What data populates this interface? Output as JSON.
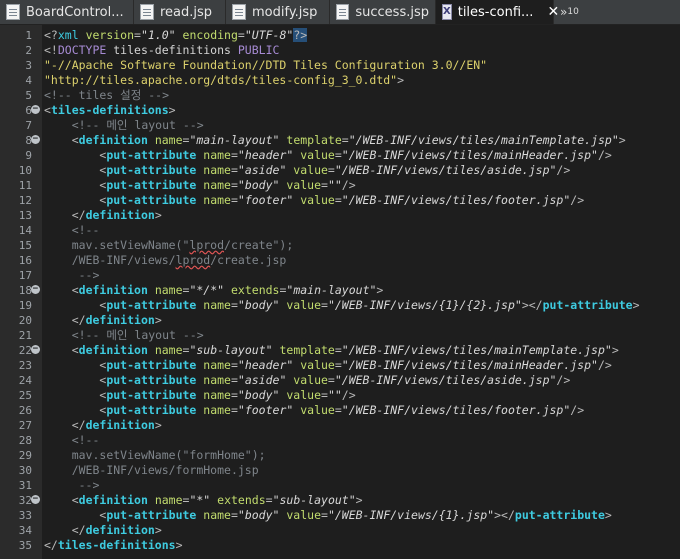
{
  "tabs": [
    {
      "label": "BoardControl...",
      "icon": "file-icon",
      "active": false
    },
    {
      "label": "read.jsp",
      "icon": "jsp-file-icon",
      "active": false
    },
    {
      "label": "modify.jsp",
      "icon": "jsp-file-icon",
      "active": false
    },
    {
      "label": "success.jsp",
      "icon": "jsp-file-icon",
      "active": false
    },
    {
      "label": "tiles-confi...",
      "icon": "xml-file-icon",
      "active": true
    }
  ],
  "overflow_label": "»",
  "overflow_count": "10",
  "close_label": "✕",
  "editor": {
    "lines": [
      {
        "n": "1",
        "fold": "",
        "segs": [
          [
            "punc",
            "<?"
          ],
          [
            "tag",
            "xml "
          ],
          [
            "attr",
            "version"
          ],
          [
            "punc",
            "="
          ],
          [
            "val",
            "\"1.0\" "
          ],
          [
            "attr",
            "encoding"
          ],
          [
            "punc",
            "="
          ],
          [
            "val",
            "\"UTF-8\""
          ],
          [
            "sel",
            "?>"
          ]
        ]
      },
      {
        "n": "2",
        "fold": "",
        "segs": [
          [
            "punc",
            "<!"
          ],
          [
            "dtk",
            "DOCTYPE "
          ],
          [
            "plain",
            "tiles-definitions "
          ],
          [
            "dtk",
            "PUBLIC"
          ]
        ]
      },
      {
        "n": "3",
        "fold": "",
        "segs": [
          [
            "dt",
            "\"-//Apache Software Foundation//DTD Tiles Configuration 3.0//EN\""
          ]
        ]
      },
      {
        "n": "4",
        "fold": "",
        "segs": [
          [
            "dt",
            "\"http://tiles.apache.org/dtds/tiles-config_3_0.dtd\""
          ],
          [
            "punc",
            ">"
          ]
        ]
      },
      {
        "n": "5",
        "fold": "",
        "segs": [
          [
            "com",
            "<!-- tiles 설정 -->"
          ]
        ]
      },
      {
        "n": "6",
        "fold": "⊖",
        "segs": [
          [
            "punc",
            "<"
          ],
          [
            "tagb",
            "tiles-definitions"
          ],
          [
            "punc",
            ">"
          ]
        ]
      },
      {
        "n": "7",
        "fold": "",
        "segs": [
          [
            "plain",
            "    "
          ],
          [
            "com",
            "<!-- 메인 layout -->"
          ]
        ]
      },
      {
        "n": "8",
        "fold": "⊖",
        "segs": [
          [
            "plain",
            "    "
          ],
          [
            "punc",
            "<"
          ],
          [
            "tagb",
            "definition "
          ],
          [
            "attr",
            "name"
          ],
          [
            "punc",
            "="
          ],
          [
            "val",
            "\"main-layout\" "
          ],
          [
            "attr",
            "template"
          ],
          [
            "punc",
            "="
          ],
          [
            "val",
            "\"/WEB-INF/views/tiles/mainTemplate.jsp\""
          ],
          [
            "punc",
            ">"
          ]
        ]
      },
      {
        "n": "9",
        "fold": "",
        "segs": [
          [
            "plain",
            "        "
          ],
          [
            "punc",
            "<"
          ],
          [
            "tagb",
            "put-attribute "
          ],
          [
            "attr",
            "name"
          ],
          [
            "punc",
            "="
          ],
          [
            "val",
            "\"header\" "
          ],
          [
            "attr",
            "value"
          ],
          [
            "punc",
            "="
          ],
          [
            "val",
            "\"/WEB-INF/views/tiles/mainHeader.jsp\""
          ],
          [
            "punc",
            "/>"
          ]
        ]
      },
      {
        "n": "10",
        "fold": "",
        "segs": [
          [
            "plain",
            "        "
          ],
          [
            "punc",
            "<"
          ],
          [
            "tagb",
            "put-attribute "
          ],
          [
            "attr",
            "name"
          ],
          [
            "punc",
            "="
          ],
          [
            "val",
            "\"aside\" "
          ],
          [
            "attr",
            "value"
          ],
          [
            "punc",
            "="
          ],
          [
            "val",
            "\"/WEB-INF/views/tiles/aside.jsp\""
          ],
          [
            "punc",
            "/>"
          ]
        ]
      },
      {
        "n": "11",
        "fold": "",
        "segs": [
          [
            "plain",
            "        "
          ],
          [
            "punc",
            "<"
          ],
          [
            "tagb",
            "put-attribute "
          ],
          [
            "attr",
            "name"
          ],
          [
            "punc",
            "="
          ],
          [
            "val",
            "\"body\" "
          ],
          [
            "attr",
            "value"
          ],
          [
            "punc",
            "="
          ],
          [
            "val",
            "\"\""
          ],
          [
            "punc",
            "/>"
          ]
        ]
      },
      {
        "n": "12",
        "fold": "",
        "segs": [
          [
            "plain",
            "        "
          ],
          [
            "punc",
            "<"
          ],
          [
            "tagb",
            "put-attribute "
          ],
          [
            "attr",
            "name"
          ],
          [
            "punc",
            "="
          ],
          [
            "val",
            "\"footer\" "
          ],
          [
            "attr",
            "value"
          ],
          [
            "punc",
            "="
          ],
          [
            "val",
            "\"/WEB-INF/views/tiles/footer.jsp\""
          ],
          [
            "punc",
            "/>"
          ]
        ]
      },
      {
        "n": "13",
        "fold": "",
        "segs": [
          [
            "plain",
            "    "
          ],
          [
            "punc",
            "</"
          ],
          [
            "tagb",
            "definition"
          ],
          [
            "punc",
            ">"
          ]
        ]
      },
      {
        "n": "14",
        "fold": "",
        "segs": [
          [
            "plain",
            "    "
          ],
          [
            "com",
            "<!--"
          ]
        ]
      },
      {
        "n": "15",
        "fold": "",
        "segs": [
          [
            "plain",
            "    "
          ],
          [
            "com",
            "mav.setViewName(\""
          ],
          [
            "comsq",
            "lprod"
          ],
          [
            "com",
            "/create\");"
          ]
        ]
      },
      {
        "n": "16",
        "fold": "",
        "segs": [
          [
            "plain",
            "    "
          ],
          [
            "com",
            "/WEB-INF/views/"
          ],
          [
            "comsq",
            "lprod"
          ],
          [
            "com",
            "/create.jsp"
          ]
        ]
      },
      {
        "n": "17",
        "fold": "",
        "segs": [
          [
            "plain",
            "     "
          ],
          [
            "com",
            "-->"
          ]
        ]
      },
      {
        "n": "18",
        "fold": "⊖",
        "segs": [
          [
            "plain",
            "    "
          ],
          [
            "punc",
            "<"
          ],
          [
            "tagb",
            "definition "
          ],
          [
            "attr",
            "name"
          ],
          [
            "punc",
            "="
          ],
          [
            "val",
            "\"*/*\" "
          ],
          [
            "attr",
            "extends"
          ],
          [
            "punc",
            "="
          ],
          [
            "val",
            "\"main-layout\""
          ],
          [
            "punc",
            ">"
          ]
        ]
      },
      {
        "n": "19",
        "fold": "",
        "segs": [
          [
            "plain",
            "        "
          ],
          [
            "punc",
            "<"
          ],
          [
            "tagb",
            "put-attribute "
          ],
          [
            "attr",
            "name"
          ],
          [
            "punc",
            "="
          ],
          [
            "val",
            "\"body\" "
          ],
          [
            "attr",
            "value"
          ],
          [
            "punc",
            "="
          ],
          [
            "val",
            "\"/WEB-INF/views/{1}/{2}.jsp\""
          ],
          [
            "punc",
            "></"
          ],
          [
            "tagb",
            "put-attribute"
          ],
          [
            "punc",
            ">"
          ]
        ]
      },
      {
        "n": "20",
        "fold": "",
        "segs": [
          [
            "plain",
            "    "
          ],
          [
            "punc",
            "</"
          ],
          [
            "tagb",
            "definition"
          ],
          [
            "punc",
            ">"
          ]
        ]
      },
      {
        "n": "21",
        "fold": "",
        "segs": [
          [
            "plain",
            "    "
          ],
          [
            "com",
            "<!-- 메인 layout -->"
          ]
        ]
      },
      {
        "n": "22",
        "fold": "⊖",
        "segs": [
          [
            "plain",
            "    "
          ],
          [
            "punc",
            "<"
          ],
          [
            "tagb",
            "definition "
          ],
          [
            "attr",
            "name"
          ],
          [
            "punc",
            "="
          ],
          [
            "val",
            "\"sub-layout\" "
          ],
          [
            "attr",
            "template"
          ],
          [
            "punc",
            "="
          ],
          [
            "val",
            "\"/WEB-INF/views/tiles/mainTemplate.jsp\""
          ],
          [
            "punc",
            ">"
          ]
        ]
      },
      {
        "n": "23",
        "fold": "",
        "segs": [
          [
            "plain",
            "        "
          ],
          [
            "punc",
            "<"
          ],
          [
            "tagb",
            "put-attribute "
          ],
          [
            "attr",
            "name"
          ],
          [
            "punc",
            "="
          ],
          [
            "val",
            "\"header\" "
          ],
          [
            "attr",
            "value"
          ],
          [
            "punc",
            "="
          ],
          [
            "val",
            "\"/WEB-INF/views/tiles/mainHeader.jsp\""
          ],
          [
            "punc",
            "/>"
          ]
        ]
      },
      {
        "n": "24",
        "fold": "",
        "segs": [
          [
            "plain",
            "        "
          ],
          [
            "punc",
            "<"
          ],
          [
            "tagb",
            "put-attribute "
          ],
          [
            "attr",
            "name"
          ],
          [
            "punc",
            "="
          ],
          [
            "val",
            "\"aside\" "
          ],
          [
            "attr",
            "value"
          ],
          [
            "punc",
            "="
          ],
          [
            "val",
            "\"/WEB-INF/views/tiles/aside.jsp\""
          ],
          [
            "punc",
            "/>"
          ]
        ]
      },
      {
        "n": "25",
        "fold": "",
        "segs": [
          [
            "plain",
            "        "
          ],
          [
            "punc",
            "<"
          ],
          [
            "tagb",
            "put-attribute "
          ],
          [
            "attr",
            "name"
          ],
          [
            "punc",
            "="
          ],
          [
            "val",
            "\"body\" "
          ],
          [
            "attr",
            "value"
          ],
          [
            "punc",
            "="
          ],
          [
            "val",
            "\"\""
          ],
          [
            "punc",
            "/>"
          ]
        ]
      },
      {
        "n": "26",
        "fold": "",
        "segs": [
          [
            "plain",
            "        "
          ],
          [
            "punc",
            "<"
          ],
          [
            "tagb",
            "put-attribute "
          ],
          [
            "attr",
            "name"
          ],
          [
            "punc",
            "="
          ],
          [
            "val",
            "\"footer\" "
          ],
          [
            "attr",
            "value"
          ],
          [
            "punc",
            "="
          ],
          [
            "val",
            "\"/WEB-INF/views/tiles/footer.jsp\""
          ],
          [
            "punc",
            "/>"
          ]
        ]
      },
      {
        "n": "27",
        "fold": "",
        "segs": [
          [
            "plain",
            "    "
          ],
          [
            "punc",
            "</"
          ],
          [
            "tagb",
            "definition"
          ],
          [
            "punc",
            ">"
          ]
        ]
      },
      {
        "n": "28",
        "fold": "",
        "segs": [
          [
            "plain",
            "    "
          ],
          [
            "com",
            "<!--"
          ]
        ]
      },
      {
        "n": "29",
        "fold": "",
        "segs": [
          [
            "plain",
            "    "
          ],
          [
            "com",
            "mav.setViewName(\"formHome\");"
          ]
        ]
      },
      {
        "n": "30",
        "fold": "",
        "segs": [
          [
            "plain",
            "    "
          ],
          [
            "com",
            "/WEB-INF/views/formHome.jsp"
          ]
        ]
      },
      {
        "n": "31",
        "fold": "",
        "segs": [
          [
            "plain",
            "     "
          ],
          [
            "com",
            "-->"
          ]
        ]
      },
      {
        "n": "32",
        "fold": "⊖",
        "segs": [
          [
            "plain",
            "    "
          ],
          [
            "punc",
            "<"
          ],
          [
            "tagb",
            "definition "
          ],
          [
            "attr",
            "name"
          ],
          [
            "punc",
            "="
          ],
          [
            "val",
            "\"*\" "
          ],
          [
            "attr",
            "extends"
          ],
          [
            "punc",
            "="
          ],
          [
            "val",
            "\"sub-layout\""
          ],
          [
            "punc",
            ">"
          ]
        ]
      },
      {
        "n": "33",
        "fold": "",
        "segs": [
          [
            "plain",
            "        "
          ],
          [
            "punc",
            "<"
          ],
          [
            "tagb",
            "put-attribute "
          ],
          [
            "attr",
            "name"
          ],
          [
            "punc",
            "="
          ],
          [
            "val",
            "\"body\" "
          ],
          [
            "attr",
            "value"
          ],
          [
            "punc",
            "="
          ],
          [
            "val",
            "\"/WEB-INF/views/{1}.jsp\""
          ],
          [
            "punc",
            "></"
          ],
          [
            "tagb",
            "put-attribute"
          ],
          [
            "punc",
            ">"
          ]
        ]
      },
      {
        "n": "34",
        "fold": "",
        "segs": [
          [
            "plain",
            "    "
          ],
          [
            "punc",
            "</"
          ],
          [
            "tagb",
            "definition"
          ],
          [
            "punc",
            ">"
          ]
        ]
      },
      {
        "n": "35",
        "fold": "",
        "segs": [
          [
            "punc",
            "</"
          ],
          [
            "tagb",
            "tiles-definitions"
          ],
          [
            "punc",
            ">"
          ]
        ]
      }
    ]
  }
}
